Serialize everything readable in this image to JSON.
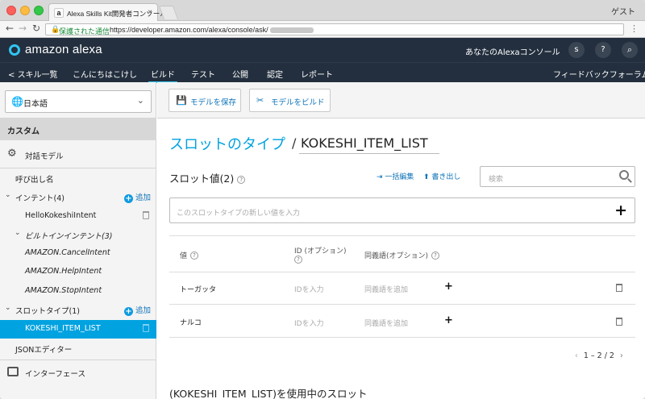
{
  "browser": {
    "tab_title": "Alexa Skills Kit開発者コンソール",
    "favicon": "a",
    "guest": "ゲスト",
    "secure_label": "保護された通信",
    "url": "https://developer.amazon.com/alexa/console/ask/"
  },
  "header": {
    "logo": "amazon alexa",
    "console_link": "あなたのAlexaコンソール",
    "avatar": "s",
    "help": "?"
  },
  "subnav": {
    "back": "スキル一覧",
    "skill_name": "こんにちはこけし",
    "tabs": [
      "ビルド",
      "テスト",
      "公開",
      "認定",
      "レポート"
    ],
    "feedback": "フィードバックフォーラム"
  },
  "sidebar": {
    "language": "日本語",
    "section": "カスタム",
    "model": "対話モデル",
    "invocation": "呼び出し名",
    "intents": "インテント(4)",
    "add": "追加",
    "intent_items": [
      "HelloKokeshiIntent"
    ],
    "builtin": "ビルトインインテント(3)",
    "builtin_items": [
      "AMAZON.CancelIntent",
      "AMAZON.HelpIntent",
      "AMAZON.StopIntent"
    ],
    "slot_types": "スロットタイプ(1)",
    "slot_items": [
      "KOKESHI_ITEM_LIST"
    ],
    "json_editor": "JSONエディター",
    "interfaces": "インターフェース"
  },
  "toolbar": {
    "save": "モデルを保存",
    "build": "モデルをビルド"
  },
  "main": {
    "title": "スロットのタイプ",
    "slash": "/",
    "slot_type_name": "KOKESHI_ITEM_LIST",
    "values_header": "スロット値(2)",
    "bulk_edit": "一括編集",
    "export": "書き出し",
    "search_placeholder": "検索",
    "new_value_placeholder": "このスロットタイプの新しい値を入力",
    "columns": [
      "値",
      "ID (オプション)",
      "同義語(オプション)"
    ],
    "id_placeholder": "IDを入力",
    "synonym_placeholder": "同義語を追加",
    "rows": [
      {
        "value": "トーガッタ"
      },
      {
        "value": "ナルコ"
      }
    ],
    "pager": "1 – 2 / 2",
    "usage_title": "(KOKESHI_ITEM_LIST)を使用中のスロット"
  },
  "colors": {
    "accent": "#00a2e0",
    "nav_bg": "#232f3e",
    "link": "#0f74b8"
  }
}
